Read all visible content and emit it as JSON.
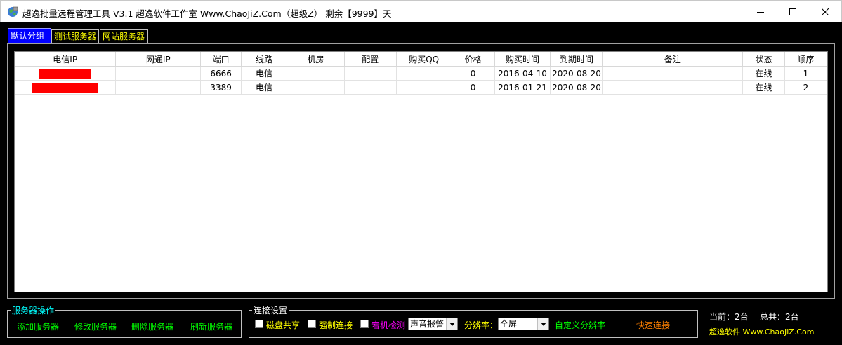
{
  "window": {
    "title": "超逸批量远程管理工具 V3.1    超逸软件工作室  Www.ChaoJiZ.Com（超级Z）    剩余【9999】天"
  },
  "tabs": [
    {
      "label": "默认分组",
      "active": true
    },
    {
      "label": "测试服务器",
      "active": false
    },
    {
      "label": "网站服务器",
      "active": false
    }
  ],
  "table": {
    "columns": [
      "电信IP",
      "网通IP",
      "端口",
      "线路",
      "机房",
      "配置",
      "购买QQ",
      "价格",
      "购买时间",
      "到期时间",
      "备注",
      "状态",
      "顺序"
    ],
    "rows": [
      {
        "port": "6666",
        "line": "电信",
        "price": "0",
        "buy": "2016-04-10",
        "expire": "2020-08-20",
        "status": "在线",
        "order": "1"
      },
      {
        "port": "3389",
        "line": "电信",
        "price": "0",
        "buy": "2016-01-21",
        "expire": "2020-08-20",
        "status": "在线",
        "order": "2"
      }
    ]
  },
  "server_ops": {
    "legend": "服务器操作",
    "add": "添加服务器",
    "edit": "修改服务器",
    "delete": "删除服务器",
    "refresh": "刷新服务器"
  },
  "conn": {
    "legend": "连接设置",
    "disk_share": "磁盘共享",
    "force_connect": "强制连接",
    "downtime_check": "宕机检测",
    "alarm_value": "声音报警",
    "resolution_label": "分辨率：",
    "resolution_value": "全屏",
    "custom_resolution": "自定义分辨率",
    "quick_connect": "快速连接"
  },
  "status": {
    "current": "当前：2台",
    "total": "总共：2台",
    "brand": "超逸软件 Www.ChaoJiZ.Com"
  },
  "colors": {
    "accent_blue": "#0000ff",
    "yellow": "#ffff00",
    "green": "#00ff00",
    "cyan": "#00ffff",
    "magenta": "#ff00ff",
    "orange": "#ff8000",
    "redaction": "#ff0000"
  }
}
